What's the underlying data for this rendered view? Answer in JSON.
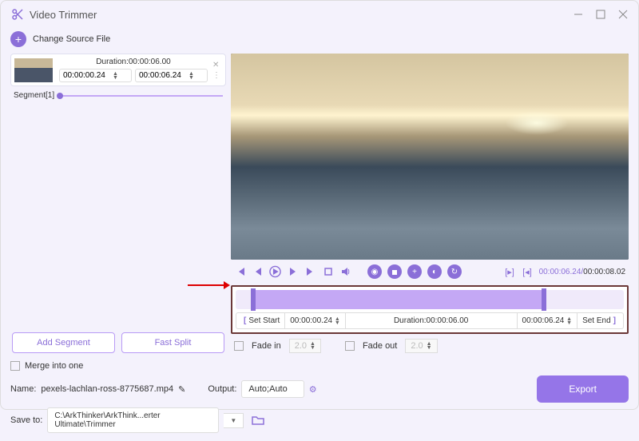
{
  "title": "Video Trimmer",
  "changeSource": "Change Source File",
  "duration": {
    "label": "Duration:00:00:06.00",
    "start": "00:00:00.24",
    "end": "00:00:06.24"
  },
  "segment": "Segment[1]",
  "addSegment": "Add Segment",
  "fastSplit": "Fast Split",
  "trim": {
    "setStart": "Set Start",
    "start": "00:00:00.24",
    "durationLabel": "Duration:00:00:06.00",
    "end": "00:00:06.24",
    "setEnd": "Set End"
  },
  "time": {
    "current": "00:00:06.24",
    "total": "00:00:08.02"
  },
  "fadeIn": "Fade in",
  "fadeOut": "Fade out",
  "fadeVal": "2.0",
  "merge": "Merge into one",
  "nameLabel": "Name:",
  "name": "pexels-lachlan-ross-8775687.mp4",
  "outputLabel": "Output:",
  "output": "Auto;Auto",
  "saveLabel": "Save to:",
  "savePath": "C:\\ArkThinker\\ArkThink...erter Ultimate\\Trimmer",
  "export": "Export"
}
